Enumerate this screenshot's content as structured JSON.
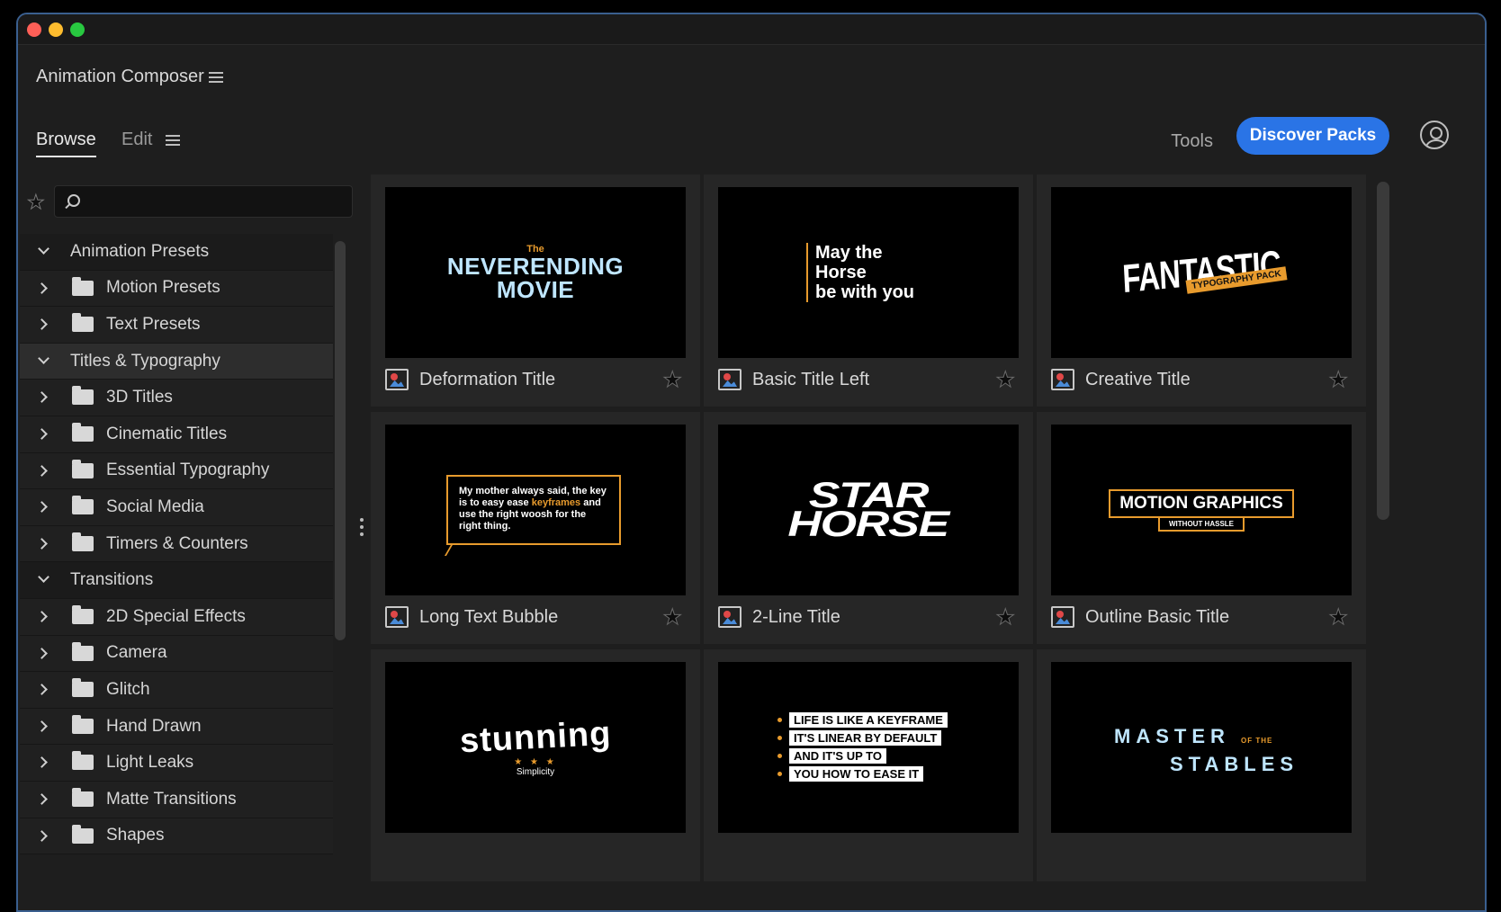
{
  "window": {
    "title": "Animation Composer"
  },
  "tabs": [
    {
      "label": "Browse",
      "active": true
    },
    {
      "label": "Edit",
      "active": false
    }
  ],
  "header": {
    "tools_label": "Tools",
    "discover_label": "Discover Packs"
  },
  "search": {
    "placeholder": ""
  },
  "tree": [
    {
      "label": "Animation Presets",
      "type": "group",
      "expanded": true
    },
    {
      "label": "Motion Presets",
      "type": "folder"
    },
    {
      "label": "Text Presets",
      "type": "folder"
    },
    {
      "label": "Titles & Typography",
      "type": "group",
      "expanded": true,
      "selected": true
    },
    {
      "label": "3D Titles",
      "type": "folder"
    },
    {
      "label": "Cinematic Titles",
      "type": "folder"
    },
    {
      "label": "Essential Typography",
      "type": "folder"
    },
    {
      "label": "Social Media",
      "type": "folder"
    },
    {
      "label": "Timers & Counters",
      "type": "folder"
    },
    {
      "label": "Transitions",
      "type": "group",
      "expanded": true
    },
    {
      "label": "2D Special Effects",
      "type": "folder"
    },
    {
      "label": "Camera",
      "type": "folder"
    },
    {
      "label": "Glitch",
      "type": "folder"
    },
    {
      "label": "Hand Drawn",
      "type": "folder"
    },
    {
      "label": "Light Leaks",
      "type": "folder"
    },
    {
      "label": "Matte Transitions",
      "type": "folder"
    },
    {
      "label": "Shapes",
      "type": "folder"
    }
  ],
  "cards": [
    {
      "name": "Deformation Title",
      "thumb": {
        "small": "The",
        "main_1": "NEVERENDING",
        "main_2": "MOVIE"
      }
    },
    {
      "name": "Basic Title Left",
      "thumb": {
        "line_1": "May the",
        "line_2": "Horse",
        "line_3": "be with you"
      }
    },
    {
      "name": "Creative Title",
      "thumb": {
        "main": "FANTASTIC",
        "tag": "TYPOGRAPHY PACK"
      }
    },
    {
      "name": "Long Text Bubble",
      "thumb": {
        "text_1": "My mother always said, the key is to easy ease",
        "highlight": "keyframes",
        "text_2": "and use the right woosh for the right thing."
      }
    },
    {
      "name": "2-Line Title",
      "thumb": {
        "line_1": "STAR",
        "line_2": "HORSE"
      }
    },
    {
      "name": "Outline Basic Title",
      "thumb": {
        "main": "MOTION GRAPHICS",
        "sub": "WITHOUT HASSLE"
      }
    },
    {
      "name": "",
      "thumb": {
        "main": "stunning",
        "stars": "★ ★ ★",
        "sub": "Simplicity"
      }
    },
    {
      "name": "",
      "thumb": {
        "lines": [
          "LIFE IS LIKE A KEYFRAME",
          "IT'S LINEAR BY DEFAULT",
          "AND IT'S UP TO",
          "YOU HOW TO EASE IT"
        ]
      }
    },
    {
      "name": "",
      "thumb": {
        "line_1": "MASTER",
        "small": "OF THE",
        "line_2": "STABLES"
      }
    }
  ],
  "colors": {
    "accent": "#2a74e6",
    "orange": "#e89b2d",
    "bg": "#1e1e1e"
  }
}
